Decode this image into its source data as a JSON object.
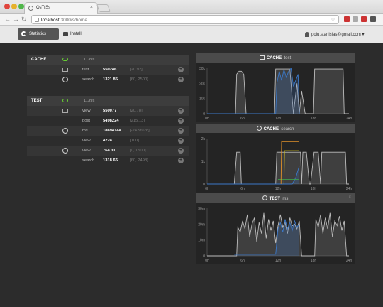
{
  "browser": {
    "tab_title": "OsTrSs",
    "tab_close": "×",
    "url_host": "localhost",
    "url_path": ":3000/s/home",
    "back": "←",
    "forward": "→",
    "reload": "↻",
    "star": "☆",
    "icons": [
      "favicon-icon",
      "back-icon",
      "forward-icon",
      "reload-icon",
      "star-icon",
      "extension-icon",
      "gmail-icon",
      "wrench-icon"
    ],
    "ext_colors": [
      "#c33",
      "#aaa",
      "#c33",
      "#555"
    ]
  },
  "nav": {
    "statistics": "Statistics",
    "install": "Install",
    "user": "polu.stanislas@gmail.com ▾"
  },
  "groups": [
    {
      "name": "CACHE",
      "count": "1139s",
      "rows": [
        {
          "icon": "chart-icon",
          "key": "test",
          "value": "550246",
          "range": "[20.92]"
        },
        {
          "icon": "timer-icon",
          "key": "search",
          "value": "1321.85",
          "range": "[60, 2500]"
        }
      ]
    },
    {
      "name": "TEST",
      "count": "1139s",
      "rows": [
        {
          "icon": "chart-icon",
          "key": "view",
          "value": "550077",
          "range": "[20.78]"
        },
        {
          "icon": "",
          "key": "post",
          "value": "5498224",
          "range": "[215.13]"
        },
        {
          "icon": "timer-icon",
          "key": "ms",
          "value": "18694144",
          "range": "[-2428928]"
        },
        {
          "icon": "",
          "key": "view",
          "value": "4224",
          "range": "[100]"
        },
        {
          "icon": "timer-icon",
          "key": "view",
          "value": "764.31",
          "range": "[0, 1500]"
        },
        {
          "icon": "",
          "key": "search",
          "value": "1318.66",
          "range": "[60, 2498]"
        }
      ]
    }
  ],
  "plus_glyph": "+",
  "panels": [
    {
      "name": "CACHE",
      "sub": "test",
      "icon": "chart-icon",
      "closable": false
    },
    {
      "name": "CACHE",
      "sub": "search",
      "icon": "timer-icon",
      "closable": false
    },
    {
      "name": "TEST",
      "sub": "ms",
      "icon": "timer-icon",
      "closable": true
    }
  ],
  "close_glyph": "×",
  "colors": {
    "line": "#bdbdbd",
    "blue": "#3b78c8",
    "orange": "#e0902a",
    "yellow": "#c8b822",
    "green": "#3ca04a",
    "accent_green": "#66cc33"
  },
  "chart_data": [
    {
      "type": "line",
      "title": "CACHE test",
      "x_ticks": [
        "0h",
        "6h",
        "12h",
        "18h",
        "24h"
      ],
      "y_ticks": [
        "0",
        "10k",
        "20k",
        "30k"
      ],
      "ylim": [
        0,
        30000
      ],
      "xlim": [
        0,
        24
      ],
      "series": [
        {
          "color": "line",
          "x": [
            0,
            4.8,
            5.0,
            5.4,
            5.8,
            6.2,
            6.6,
            11.4,
            11.6,
            14.0,
            14.6,
            15.2,
            15.6,
            16.0,
            16.6,
            17.0,
            17.5,
            18.0,
            18.2,
            23.0,
            23.2,
            24
          ],
          "y": [
            0,
            0,
            26000,
            28000,
            28000,
            26000,
            0,
            0,
            29500,
            29500,
            0,
            20000,
            0,
            15000,
            0,
            0,
            0,
            0,
            29500,
            29500,
            0,
            0
          ]
        },
        {
          "color": "blue",
          "x": [
            0,
            11.6,
            11.8,
            12.2,
            12.6,
            13.0,
            13.4,
            13.8,
            14.2,
            14.6,
            15.0,
            15.4,
            15.6
          ],
          "y": [
            0,
            0,
            20000,
            28000,
            22000,
            29000,
            24000,
            28000,
            30000,
            18000,
            22000,
            26000,
            0
          ]
        }
      ]
    },
    {
      "type": "line",
      "title": "CACHE search",
      "x_ticks": [
        "0h",
        "6h",
        "12h",
        "18h",
        "24h"
      ],
      "y_ticks": [
        "0",
        "1k",
        "2k"
      ],
      "ylim": [
        0,
        3000
      ],
      "xlim": [
        0,
        24
      ],
      "series": [
        {
          "color": "line",
          "x": [
            0,
            4.6,
            5.0,
            5.6,
            5.8,
            11.6,
            11.8,
            12.5,
            13.2,
            13.8,
            14.4,
            15.0,
            15.8,
            16.0,
            16.2,
            16.8,
            17.3,
            17.5,
            18.1,
            18.3,
            18.8,
            19.2,
            19.4,
            23.4,
            23.6,
            24
          ],
          "y": [
            0,
            0,
            2100,
            2100,
            0,
            0,
            2100,
            2100,
            2100,
            2100,
            2100,
            2100,
            2100,
            0,
            2100,
            2100,
            0,
            0,
            2100,
            2100,
            2100,
            0,
            2100,
            2100,
            0,
            0
          ]
        },
        {
          "color": "blue",
          "x": [
            0,
            14.4,
            15.0,
            15.6
          ],
          "y": [
            0,
            0,
            420,
            1200
          ]
        },
        {
          "color": "green",
          "x": [
            12.0,
            15.6
          ],
          "y": [
            300,
            300
          ]
        },
        {
          "color": "orange",
          "x": [
            12.5,
            12.6,
            15.6
          ],
          "y": [
            0,
            2800,
            2800
          ]
        },
        {
          "color": "yellow",
          "x": [
            13.0,
            13.1,
            15.6
          ],
          "y": [
            0,
            2200,
            2200
          ]
        }
      ]
    },
    {
      "type": "line",
      "title": "TEST ms",
      "x_ticks": [
        "0h",
        "6h",
        "12h",
        "18h",
        "24h"
      ],
      "y_ticks": [
        "0",
        "10m",
        "20m",
        "30m"
      ],
      "ylim": [
        0,
        30000000
      ],
      "xlim": [
        0,
        24
      ],
      "series": [
        {
          "color": "line",
          "x": [
            0,
            5.0,
            5.2,
            5.6,
            6.0,
            6.4,
            6.8,
            7.2,
            7.6,
            8.0,
            8.4,
            8.8,
            9.2,
            9.6,
            10.0,
            10.4,
            10.8,
            11.2,
            11.6,
            12.0,
            12.4,
            12.8,
            13.2,
            13.6,
            14.0,
            14.4,
            14.8,
            15.2,
            15.6,
            16.0,
            16.3,
            16.5,
            18.2,
            18.4,
            18.8,
            19.2,
            19.6,
            20.0,
            20.4,
            20.8,
            21.2,
            21.6,
            22.0,
            22.4,
            22.8,
            23.2,
            23.6,
            24
          ],
          "y": [
            0,
            0,
            18000000,
            15000000,
            22000000,
            17000000,
            26000000,
            12000000,
            20000000,
            24000000,
            9000000,
            21000000,
            14000000,
            27000000,
            11000000,
            23000000,
            16000000,
            22000000,
            8000000,
            19000000,
            26000000,
            18000000,
            21000000,
            14000000,
            24000000,
            19000000,
            20000000,
            17000000,
            22000000,
            0,
            0,
            0,
            0,
            23000000,
            18000000,
            26000000,
            14000000,
            24000000,
            17000000,
            27000000,
            12000000,
            22000000,
            19000000,
            25000000,
            16000000,
            22000000,
            0,
            0
          ]
        },
        {
          "color": "blue",
          "x": [
            4.6,
            11.6,
            12.0,
            12.4,
            12.8,
            13.2,
            13.6,
            14.0,
            14.4,
            14.8,
            15.2,
            15.6
          ],
          "y": [
            1000000,
            1000000,
            17000000,
            21000000,
            15000000,
            23000000,
            17000000,
            21000000,
            16000000,
            22000000,
            18000000,
            20000000
          ]
        }
      ]
    }
  ]
}
